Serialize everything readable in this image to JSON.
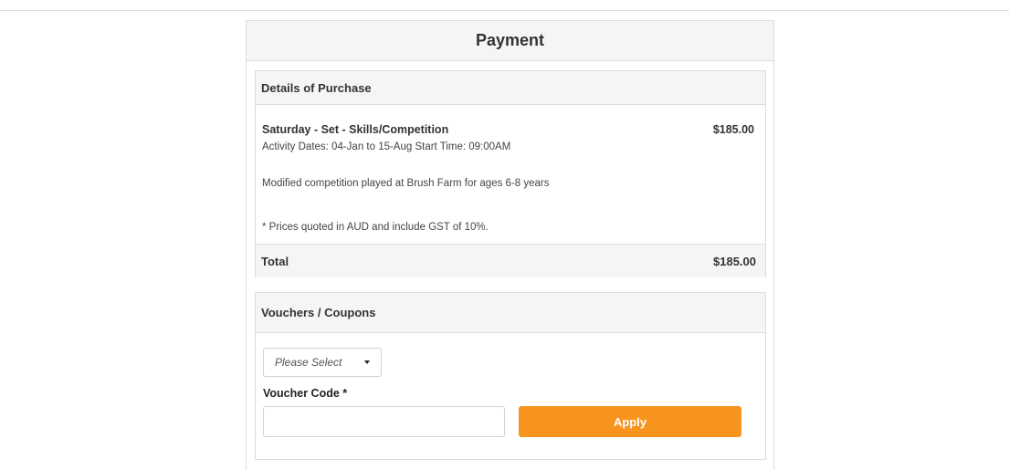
{
  "payment": {
    "title": "Payment"
  },
  "purchase": {
    "heading": "Details of Purchase",
    "item_name": "Saturday - Set - Skills/Competition",
    "item_price": "$185.00",
    "item_dates": "Activity Dates: 04-Jan to 15-Aug Start Time: 09:00AM",
    "item_description": "Modified competition played at Brush Farm for ages 6-8 years",
    "gst_note": "* Prices quoted in AUD and include GST of 10%.",
    "total_label": "Total",
    "total_value": "$185.00"
  },
  "vouchers": {
    "heading": "Vouchers / Coupons",
    "select_value": "Please Select",
    "code_label": "Voucher Code *",
    "code_value": "",
    "apply_label": "Apply"
  },
  "colors": {
    "accent": "#f7941d",
    "header_bg": "#f4f5f6",
    "border": "#dadde1"
  }
}
